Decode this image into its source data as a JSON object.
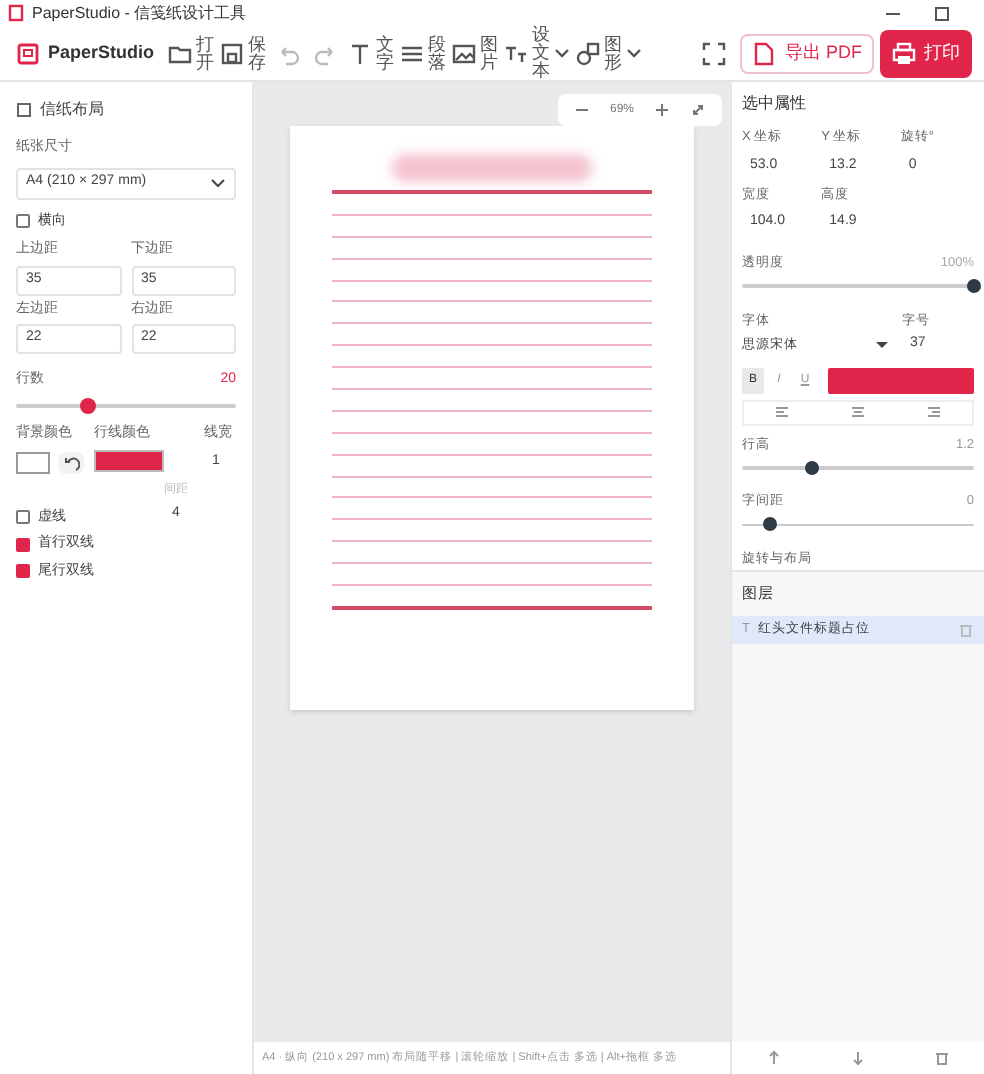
{
  "window": {
    "title": "PaperStudio - 信笺纸设计工具"
  },
  "toolbar": {
    "brand": "PaperStudio",
    "items": [
      {
        "kind": "button",
        "label": "打开"
      },
      {
        "kind": "button",
        "label": "保存"
      },
      {
        "kind": "undo"
      },
      {
        "kind": "redo"
      },
      {
        "kind": "button",
        "label": "文字"
      },
      {
        "kind": "button",
        "label": "段落"
      },
      {
        "kind": "button",
        "label": "图片"
      },
      {
        "kind": "dropdown",
        "label": "设文本"
      },
      {
        "kind": "dropdown",
        "label": "图形"
      }
    ],
    "export": "导出 PDF",
    "print": "打印"
  },
  "left": {
    "title": "信纸布局",
    "size_label": "纸张尺寸",
    "size_value": "A4 (210 × 297 mm)",
    "landscape": {
      "label": "横向",
      "checked": false
    },
    "margins": [
      {
        "label": "上边距",
        "value": "35"
      },
      {
        "label": "下边距",
        "value": "35"
      },
      {
        "label": "左边距",
        "value": "22"
      },
      {
        "label": "右边距",
        "value": "22"
      }
    ],
    "rows": {
      "label": "行数",
      "value": "20",
      "level": 0.33
    },
    "bg_label": "背景颜色",
    "line_color_label": "行线颜色",
    "width_label": "线宽",
    "width_value": "1",
    "gap_label": "间距",
    "gap_value": "4",
    "options": [
      {
        "label": "虚线",
        "checked": false
      },
      {
        "label": "首行双线",
        "checked": true
      },
      {
        "label": "尾行双线",
        "checked": true
      }
    ]
  },
  "canvas": {
    "zoom": "69%"
  },
  "right": {
    "title": "选中属性",
    "fields": [
      {
        "label": "X 坐标",
        "value": "53.0"
      },
      {
        "label": "Y 坐标",
        "value": "13.2"
      },
      {
        "label": "旋转°",
        "value": "0"
      },
      {
        "label": "宽度",
        "value": "104.0"
      },
      {
        "label": "高度",
        "value": "14.9"
      }
    ],
    "opacity": {
      "label": "透明度",
      "value": "100%",
      "level": 1
    },
    "font_label": "字体",
    "font_value": "思源宋体",
    "size_label": "字号",
    "size_value": "37",
    "styles": [
      {
        "label": "B",
        "selected": true
      },
      {
        "label": "I",
        "selected": false
      },
      {
        "label": "U",
        "selected": false
      }
    ],
    "line_height": {
      "label": "行高",
      "value": "1.2",
      "level": 0.3
    },
    "spacing": {
      "label": "字间距",
      "value": "0",
      "level": 0.12
    },
    "layout_label": "旋转与布局",
    "layers_title": "图层",
    "layers": [
      {
        "icon": "T",
        "label": "红头文件标题占位",
        "selected": true
      }
    ]
  },
  "status_bar": "A4 · 纵向 (210 x 297 mm)   布局随平移 | 滚轮缩放 | Shift+点击 多选 | Alt+拖框 多选"
}
